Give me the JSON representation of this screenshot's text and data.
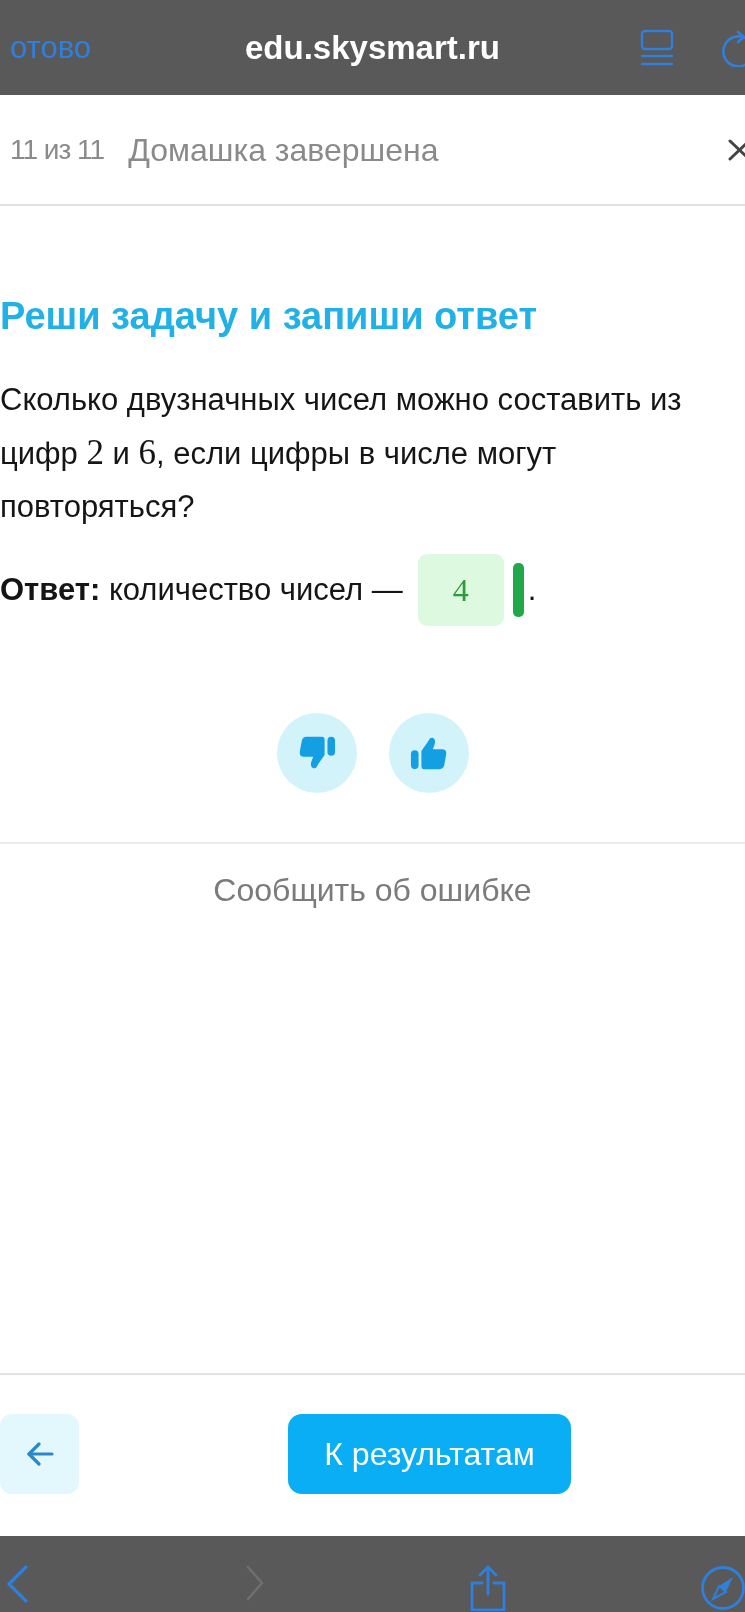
{
  "browser_bar": {
    "done_label": "отово",
    "url": "edu.skysmart.ru"
  },
  "lesson_header": {
    "progress": "11 из 11",
    "status": "Домашка завершена"
  },
  "task": {
    "title": "Реши задачу и запиши ответ",
    "question": [
      {
        "kind": "text",
        "text": "Сколько двузначных чисел можно составить из цифр "
      },
      {
        "kind": "math",
        "text": "2"
      },
      {
        "kind": "text",
        "text": " и "
      },
      {
        "kind": "math",
        "text": "6"
      },
      {
        "kind": "text",
        "text": ", если цифры в числе могут повторяться?"
      }
    ],
    "answer": {
      "label": "**Ответ:** количество чисел —",
      "value": "4",
      "correct": true,
      "suffix": "."
    }
  },
  "report_link": "Сообщить об ошибке",
  "footer": {
    "primary_button": "К результатам"
  },
  "browser_toolbar": {
    "buttons": [
      {
        "kind": "back",
        "disabled": false
      },
      {
        "kind": "forward",
        "disabled": true
      },
      {
        "kind": "share",
        "disabled": false
      },
      {
        "kind": "compass",
        "disabled": false
      }
    ]
  }
}
